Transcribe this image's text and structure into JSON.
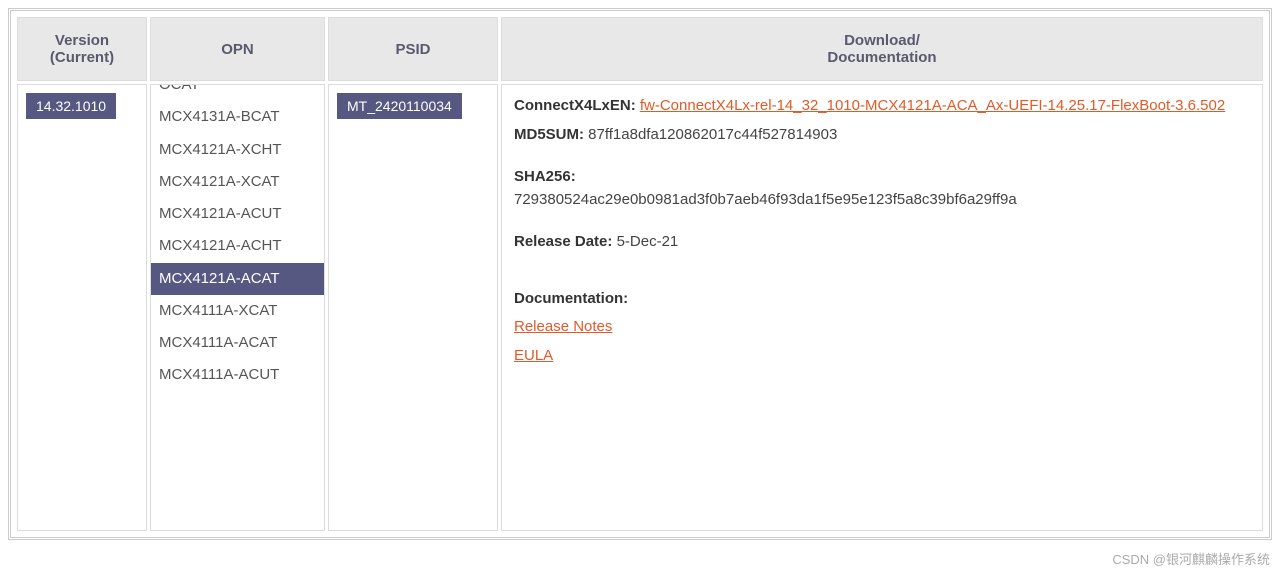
{
  "headers": {
    "version": "Version (Current)",
    "opn": "OPN",
    "psid": "PSID",
    "download": "Download/\nDocumentation"
  },
  "version_current": "14.32.1010",
  "opn": {
    "items": [
      {
        "label": "MCX4131A-BCAT",
        "selected": false
      },
      {
        "label": "MCX4121A-XCHT",
        "selected": false
      },
      {
        "label": "MCX4121A-XCAT",
        "selected": false
      },
      {
        "label": "MCX4121A-ACUT",
        "selected": false
      },
      {
        "label": "MCX4121A-ACHT",
        "selected": false
      },
      {
        "label": "MCX4121A-ACAT",
        "selected": true
      },
      {
        "label": "MCX4111A-XCAT",
        "selected": false
      }
    ]
  },
  "psid_value": "MT_2420110034",
  "detail": {
    "product_label": "ConnectX4LxEN:",
    "download_link": "fw-ConnectX4Lx-rel-14_32_1010-MCX4121A-ACA_Ax-UEFI-14.25.17-FlexBoot-3.6.502",
    "md5_label": "MD5SUM:",
    "md5_value": "87ff1a8dfa120862017c44f527814903",
    "sha_label": "SHA256:",
    "sha_value": "729380524ac29e0b0981ad3f0b7aeb46f93da1f5e95e123f5a8c39bf6a29ff9a",
    "release_label": "Release Date:",
    "release_value": "5-Dec-21",
    "doc_label": "Documentation:",
    "doc_links": {
      "release_notes": "Release Notes",
      "eula": "EULA"
    }
  },
  "watermark": "CSDN @银河麒麟操作系统"
}
